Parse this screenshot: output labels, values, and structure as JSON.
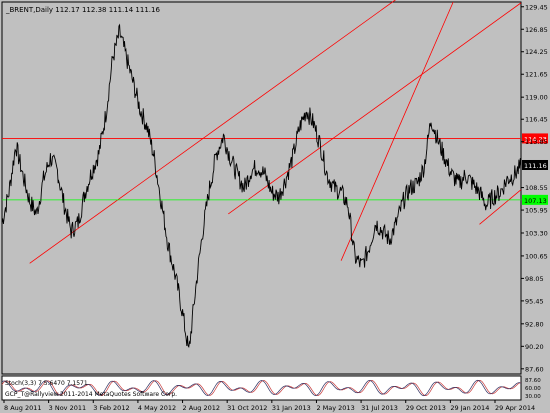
{
  "title": "_BRENT,Daily  112.17 112.38 111.14 111.16",
  "colors": {
    "background": "#C0C0C0",
    "plot_bg": "#C0C0C0",
    "price": "#000000",
    "axis": "#000000",
    "trendline": "#FF0000",
    "hline_red": "#FF0000",
    "hline_green": "#00FF00",
    "osc_bg": "#FFFFFF",
    "osc_line": "#C83C3C",
    "osc_signal": "#303060"
  },
  "chart_data": {
    "type": "line",
    "title": "_BRENT,Daily  112.17 112.38 111.14 111.16",
    "symbol": "_BRENT",
    "timeframe": "Daily",
    "ohlc": {
      "open": 112.17,
      "high": 112.38,
      "low": 111.14,
      "close": 111.16
    },
    "ylim": [
      87.0,
      130.0
    ],
    "y_ticks": [
      "129.45",
      "126.85",
      "124.25",
      "121.65",
      "119.00",
      "116.45",
      "113.85",
      "111.16",
      "108.55",
      "105.95",
      "103.30",
      "100.65",
      "98.05",
      "95.45",
      "92.80",
      "90.20",
      "87.60"
    ],
    "x_ticks": [
      "8 Aug 2011",
      "3 Nov 2011",
      "3 Feb 2012",
      "4 May 2012",
      "2 Aug 2012",
      "31 Oct 2012",
      "31 Jan 2013",
      "2 May 2013",
      "31 Jul 2013",
      "29 Oct 2013",
      "29 Jan 2014",
      "29 Apr 2014"
    ],
    "x": [
      0,
      10,
      20,
      30,
      40,
      50,
      60,
      70,
      80,
      90,
      100,
      110,
      120,
      130,
      140,
      150,
      160,
      170,
      180,
      190,
      200,
      210,
      220,
      230,
      240,
      250,
      260,
      270,
      280,
      290,
      300,
      310,
      320,
      330,
      340,
      350,
      360,
      370,
      380,
      390,
      400,
      410,
      420,
      430,
      440,
      450,
      460,
      470,
      480,
      490,
      500,
      510,
      520,
      530,
      540,
      550,
      560,
      570,
      580,
      590,
      600,
      610,
      620,
      630,
      640,
      650,
      660,
      670,
      680,
      690,
      700,
      710,
      720,
      730,
      740,
      750
    ],
    "close": [
      104.5,
      108.0,
      113.5,
      110.0,
      107.0,
      105.5,
      109.5,
      112.0,
      110.5,
      106.5,
      103.5,
      104.5,
      108.0,
      110.5,
      112.5,
      117.0,
      123.5,
      126.5,
      123.5,
      120.5,
      117.5,
      115.5,
      112.0,
      107.0,
      102.0,
      98.5,
      94.5,
      89.5,
      97.0,
      103.5,
      108.5,
      112.5,
      114.5,
      112.0,
      110.0,
      108.5,
      110.5,
      111.0,
      110.0,
      108.0,
      107.5,
      109.5,
      112.0,
      115.5,
      117.5,
      116.0,
      113.5,
      110.0,
      108.5,
      108.0,
      106.5,
      100.5,
      99.5,
      101.5,
      104.5,
      103.5,
      102.5,
      104.5,
      107.0,
      108.5,
      109.0,
      111.0,
      116.5,
      114.0,
      112.0,
      110.0,
      109.0,
      110.0,
      109.0,
      108.0,
      106.5,
      107.5,
      108.0,
      109.5,
      110.0,
      111.0
    ],
    "horizontal_levels": [
      {
        "label": "114.23",
        "value": 114.23,
        "color": "#FF0000"
      },
      {
        "label": "107.13",
        "value": 107.13,
        "color": "#00FF00"
      }
    ],
    "current_price_label": "111.16",
    "trendlines": [
      {
        "x": [
          40,
          573
        ],
        "y": [
          99.8,
          130.5
        ]
      },
      {
        "x": [
          327,
          750
        ],
        "y": [
          105.5,
          129.9
        ]
      },
      {
        "x": [
          490,
          652
        ],
        "y": [
          100.1,
          130.0
        ]
      },
      {
        "x": [
          690,
          750
        ],
        "y": [
          104.3,
          108.3
        ]
      }
    ],
    "grid": false,
    "oscillator": {
      "label": "Stoch(3,3) 7 5.6470 7.1571",
      "label2": "GCP_T@Rallyview.2011-2014 MetaQuotes Software Corp.",
      "ylim": [
        0,
        100
      ],
      "y_ticks": [
        "87.60",
        "60.00",
        "30.00"
      ]
    }
  }
}
